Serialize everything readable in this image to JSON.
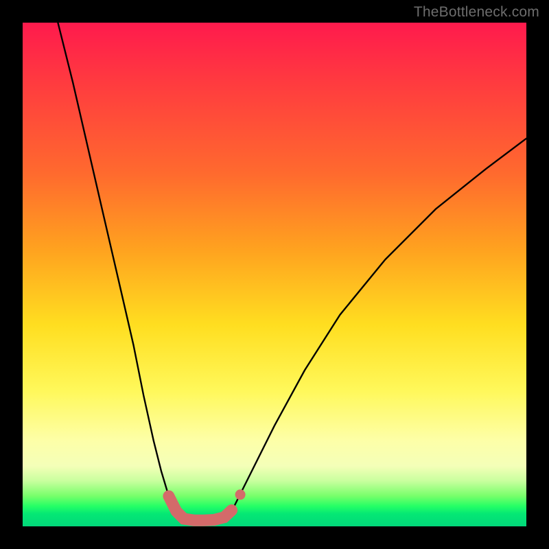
{
  "watermark": "TheBottleneck.com",
  "colors": {
    "frame": "#000000",
    "curve_primary": "#000000",
    "curve_highlight": "#d46a6a",
    "gradient_top": "#ff1a4d",
    "gradient_mid": "#ffde20",
    "gradient_bottom": "#02d87a"
  },
  "chart_data": {
    "type": "line",
    "title": "",
    "xlabel": "",
    "ylabel": "",
    "xlim": [
      0,
      100
    ],
    "ylim": [
      0,
      100
    ],
    "series": [
      {
        "name": "left-arm",
        "x": [
          7,
          10,
          13,
          16,
          19,
          22,
          24,
          26,
          27.5,
          29,
          30.5,
          32
        ],
        "y": [
          100,
          88,
          75,
          62,
          49,
          36,
          26,
          17,
          11,
          6,
          3,
          1.5
        ]
      },
      {
        "name": "valley-floor",
        "x": [
          32,
          34,
          36,
          38,
          40
        ],
        "y": [
          1.5,
          1.2,
          1.2,
          1.3,
          1.8
        ]
      },
      {
        "name": "right-arm",
        "x": [
          40,
          42,
          45,
          50,
          56,
          63,
          72,
          82,
          92,
          100
        ],
        "y": [
          1.8,
          4,
          10,
          20,
          31,
          42,
          53,
          63,
          71,
          77
        ]
      },
      {
        "name": "highlight-segment",
        "x": [
          29,
          30.5,
          32,
          34,
          36,
          38,
          40,
          41.5
        ],
        "y": [
          6,
          3,
          1.5,
          1.2,
          1.2,
          1.3,
          1.8,
          3.2
        ]
      },
      {
        "name": "highlight-endpoint",
        "x": [
          43.2
        ],
        "y": [
          6.3
        ]
      }
    ]
  }
}
